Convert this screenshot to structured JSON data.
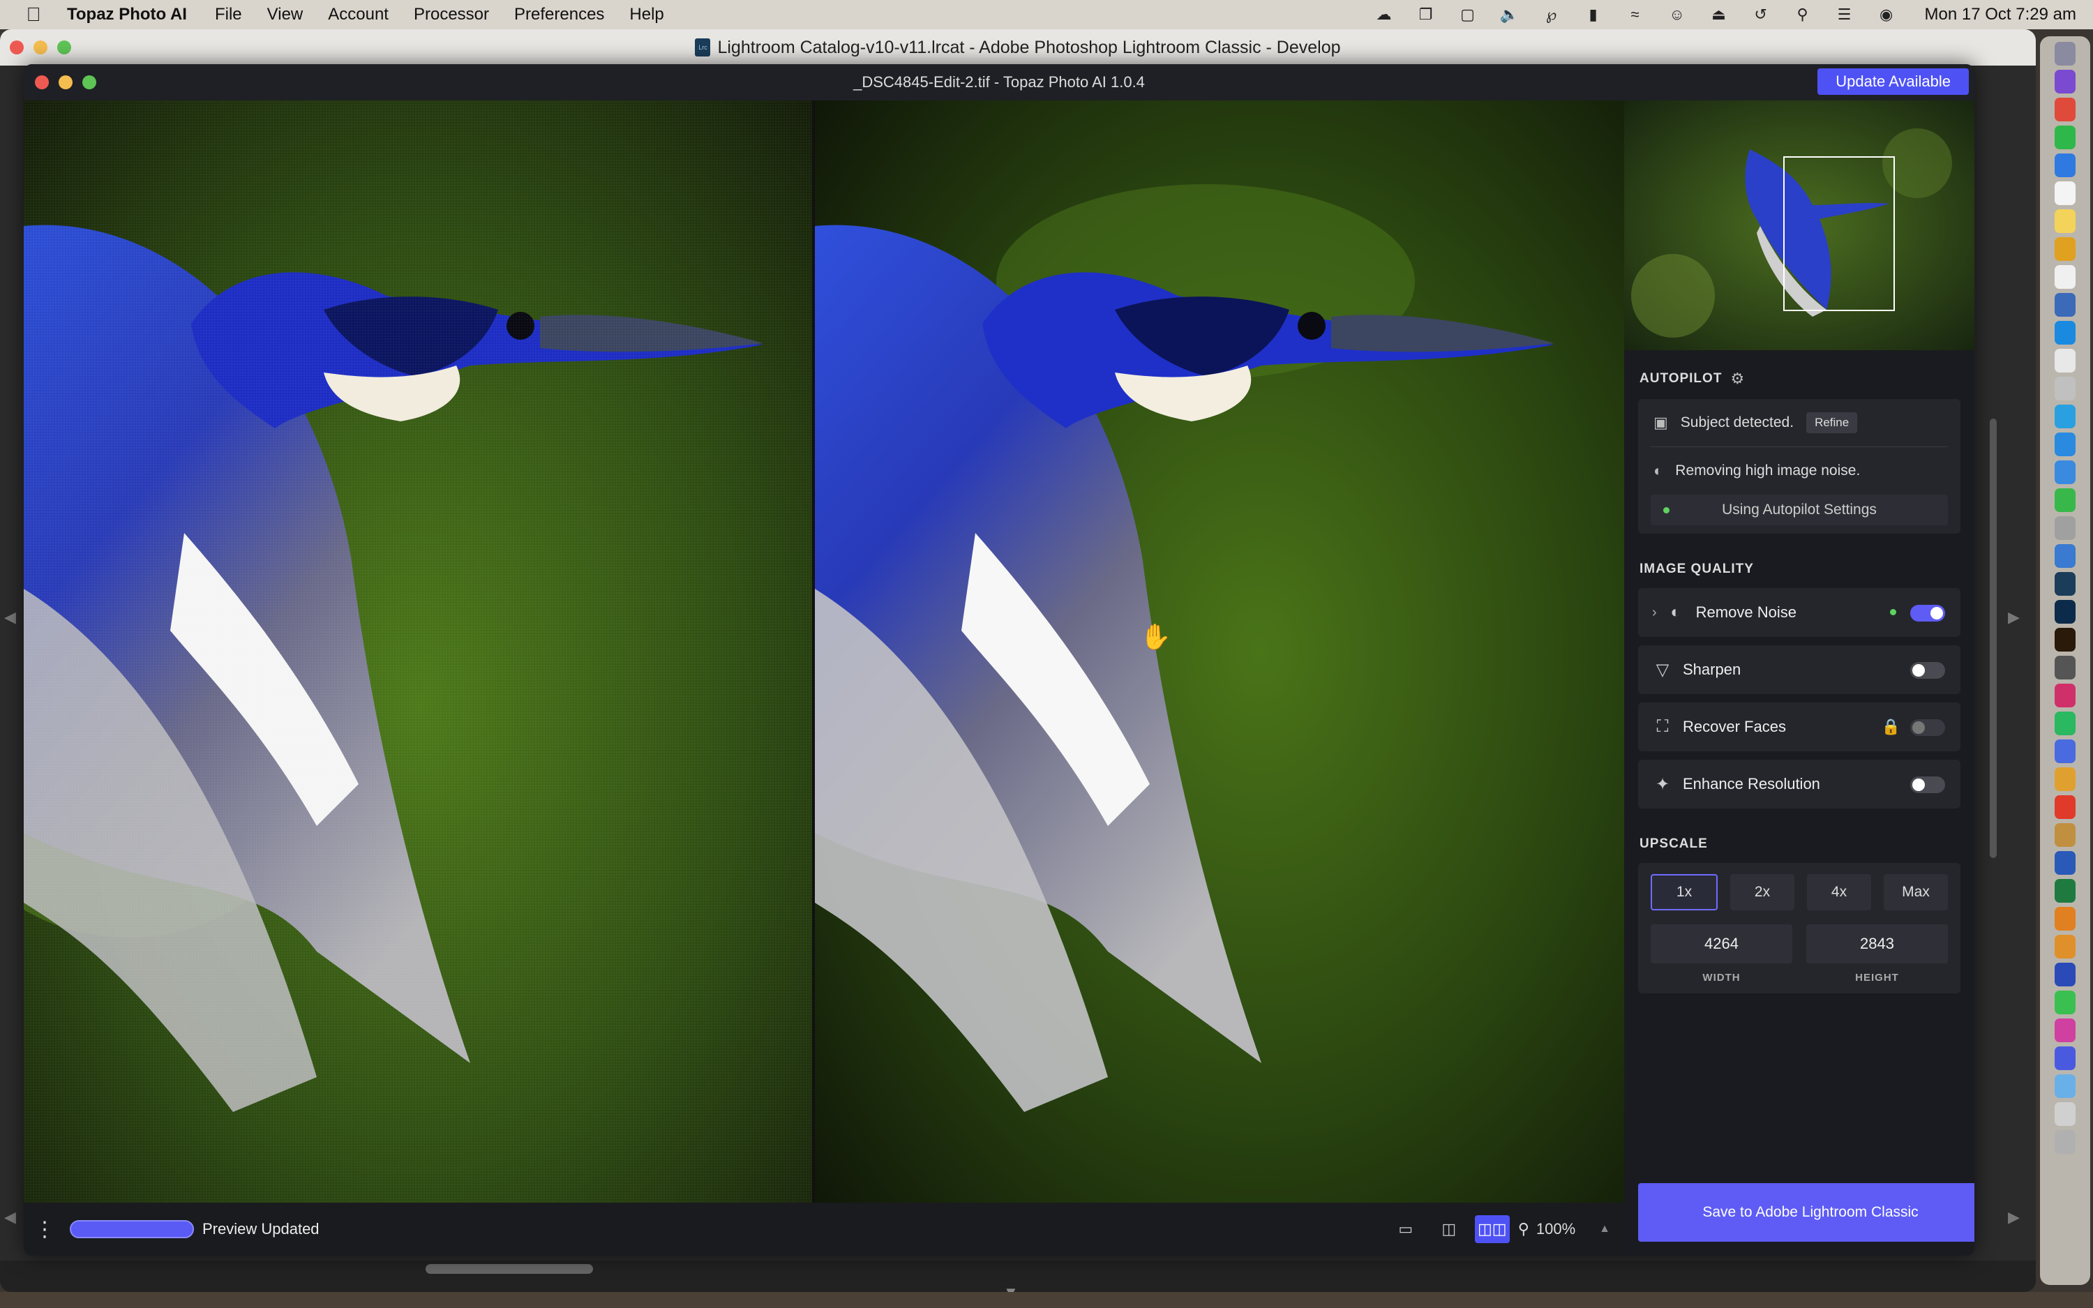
{
  "menubar": {
    "app_name": "Topaz Photo AI",
    "items": [
      "File",
      "View",
      "Account",
      "Processor",
      "Preferences",
      "Help"
    ],
    "clock": "Mon 17 Oct  7:29 am"
  },
  "lightroom": {
    "title": "Lightroom Catalog-v10-v11.lrcat - Adobe Photoshop Lightroom Classic - Develop",
    "doc_icon": "Lrc"
  },
  "topaz": {
    "title": "_DSC4845-Edit-2.tif - Topaz Photo AI 1.0.4",
    "update_label": "Update Available",
    "bottom": {
      "progress": 1.0,
      "status": "Preview Updated",
      "zoom": "100%"
    },
    "sidebar": {
      "autopilot": {
        "title": "AUTOPILOT",
        "subject": "Subject detected.",
        "refine_label": "Refine",
        "noise": "Removing high image noise.",
        "using": "Using Autopilot Settings"
      },
      "image_quality": {
        "title": "IMAGE QUALITY",
        "items": [
          {
            "label": "Remove Noise",
            "enabled": true
          },
          {
            "label": "Sharpen",
            "enabled": false
          },
          {
            "label": "Recover Faces",
            "enabled": false,
            "locked": true
          },
          {
            "label": "Enhance Resolution",
            "enabled": false
          }
        ]
      },
      "upscale": {
        "title": "UPSCALE",
        "options": [
          "1x",
          "2x",
          "4x",
          "Max"
        ],
        "selected": "1x",
        "width": "4264",
        "height": "2843",
        "width_label": "WIDTH",
        "height_label": "HEIGHT"
      },
      "save_label": "Save to Adobe Lightroom Classic"
    }
  },
  "colors": {
    "accent": "#5e5cf5",
    "panel": "#1a1b20",
    "card": "#25262c"
  }
}
